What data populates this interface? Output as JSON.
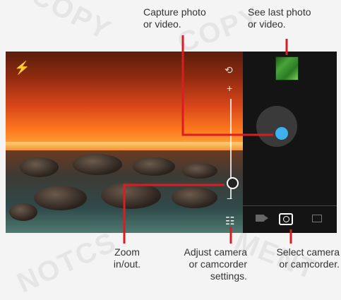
{
  "callouts": {
    "capture": [
      "Capture photo",
      "or video."
    ],
    "last_photo": [
      "See last photo",
      "or video."
    ],
    "zoom": [
      "Zoom",
      "in/out."
    ],
    "adjust": [
      "Adjust camera",
      "or camcorder",
      "settings."
    ],
    "select": [
      "Select camera",
      "or camcorder."
    ]
  },
  "controls": {
    "zoom_plus": "+",
    "zoom_minus": "−"
  },
  "colors": {
    "callout_line": "#d91d25",
    "shutter": "#3fb1ee"
  },
  "icons": [
    "flash-auto-icon",
    "switch-camera-icon",
    "settings-icon",
    "video-mode-icon",
    "photo-mode-icon",
    "panorama-mode-icon"
  ]
}
